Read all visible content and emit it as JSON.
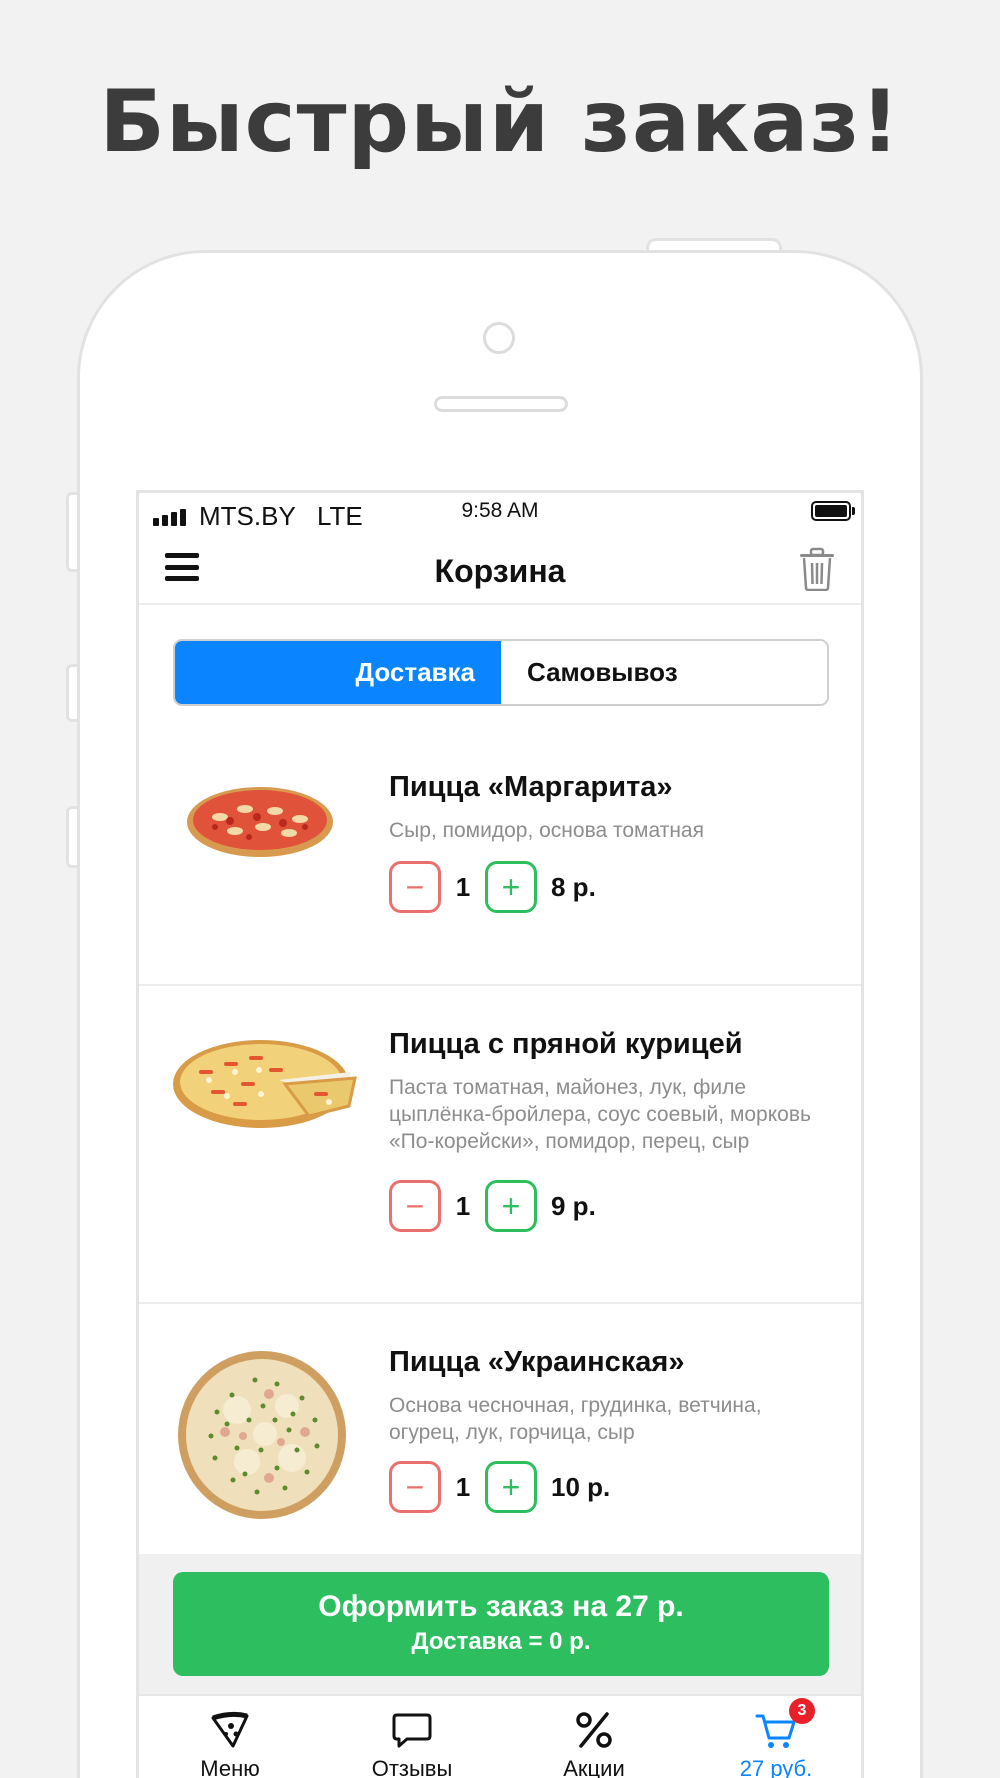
{
  "headline": "Быстрый заказ!",
  "statusbar": {
    "carrier": "MTS.BY   LTE",
    "time": "9:58 AM"
  },
  "navbar": {
    "title": "Корзина"
  },
  "delivery_toggle": {
    "options": [
      "Доставка",
      "Самовывоз"
    ],
    "selected": "Доставка"
  },
  "cart": {
    "items": [
      {
        "name": "Пицца «Маргарита»",
        "description": "Сыр, помидор, основа томатная",
        "quantity": "1",
        "price": "8 р.",
        "image_icon": "pizza-margherita-image"
      },
      {
        "name": "Пицца с пряной курицей",
        "description": "Паста томатная, майонез, лук, филе цыплёнка-бройлера, соус соевый, морковь «По-корейски», помидор, перец, сыр",
        "quantity": "1",
        "price": "9 р.",
        "image_icon": "pizza-spicy-chicken-image"
      },
      {
        "name": "Пицца «Украинская»",
        "description": "Основа чесночная, грудинка, ветчина, огурец, лук, горчица, сыр",
        "quantity": "1",
        "price": "10 р.",
        "image_icon": "pizza-ukrainian-image"
      }
    ],
    "minus_symbol": "−",
    "plus_symbol": "+"
  },
  "order_button": {
    "line1": "Оформить заказ на 27 р.",
    "line2": "Доставка = 0 р."
  },
  "tabbar": {
    "tabs": [
      {
        "label": "Меню",
        "icon": "pizza-slice-icon"
      },
      {
        "label": "Отзывы",
        "icon": "chat-bubble-icon"
      },
      {
        "label": "Акции",
        "icon": "percent-icon"
      },
      {
        "label": "27 руб.",
        "icon": "cart-icon",
        "badge": "3"
      }
    ],
    "active_index": 3
  },
  "colors": {
    "accent": "#0a84ff",
    "green": "#2dbe60",
    "minus": "#e9706f",
    "badge": "#e8202a"
  }
}
